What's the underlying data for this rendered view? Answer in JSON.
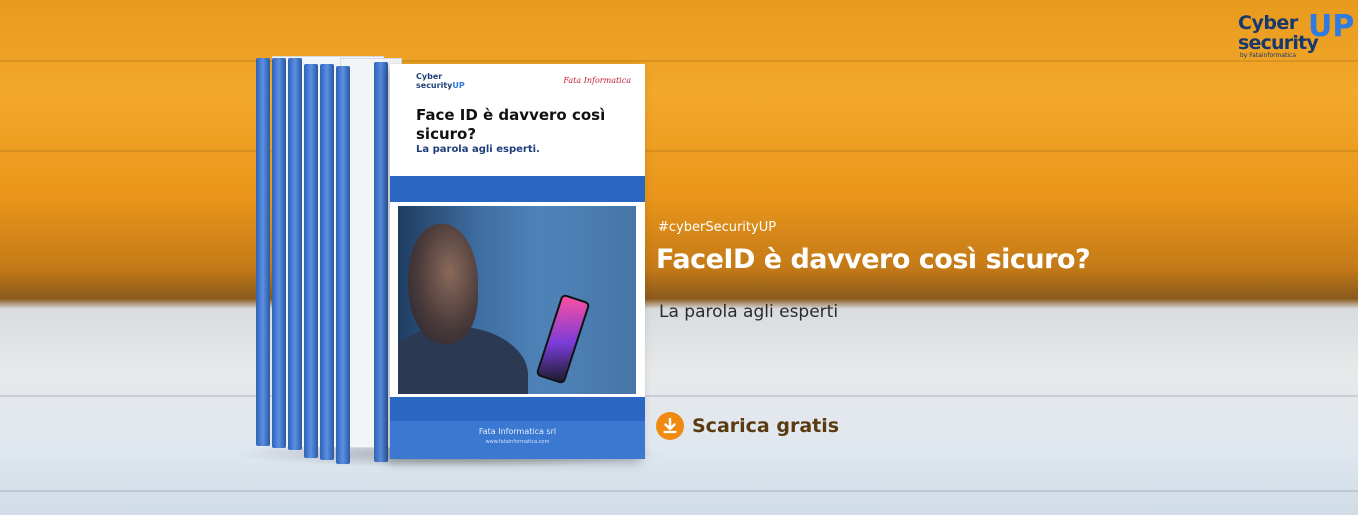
{
  "banner": {
    "hashtag": "#cyberSecurityUP",
    "headline": "FaceID è davvero così sicuro?",
    "subheadline": "La parola agli esperti",
    "cta_label": "Scarica gratis",
    "cta_icon": "download-icon",
    "accent_color": "#f08a10"
  },
  "logo": {
    "line1": "Cyber",
    "line2": "security",
    "accent": "UP",
    "byline": "by Fatainformatica"
  },
  "ebook_cover": {
    "logo_line1": "Cyber",
    "logo_line2": "security",
    "logo_accent": "UP",
    "brand": "Fata Informatica",
    "title": "Face ID è davvero così sicuro?",
    "subtitle": "La parola agli esperti.",
    "publisher": "Fata Informatica srl",
    "url": "www.fatainformatica.com"
  }
}
